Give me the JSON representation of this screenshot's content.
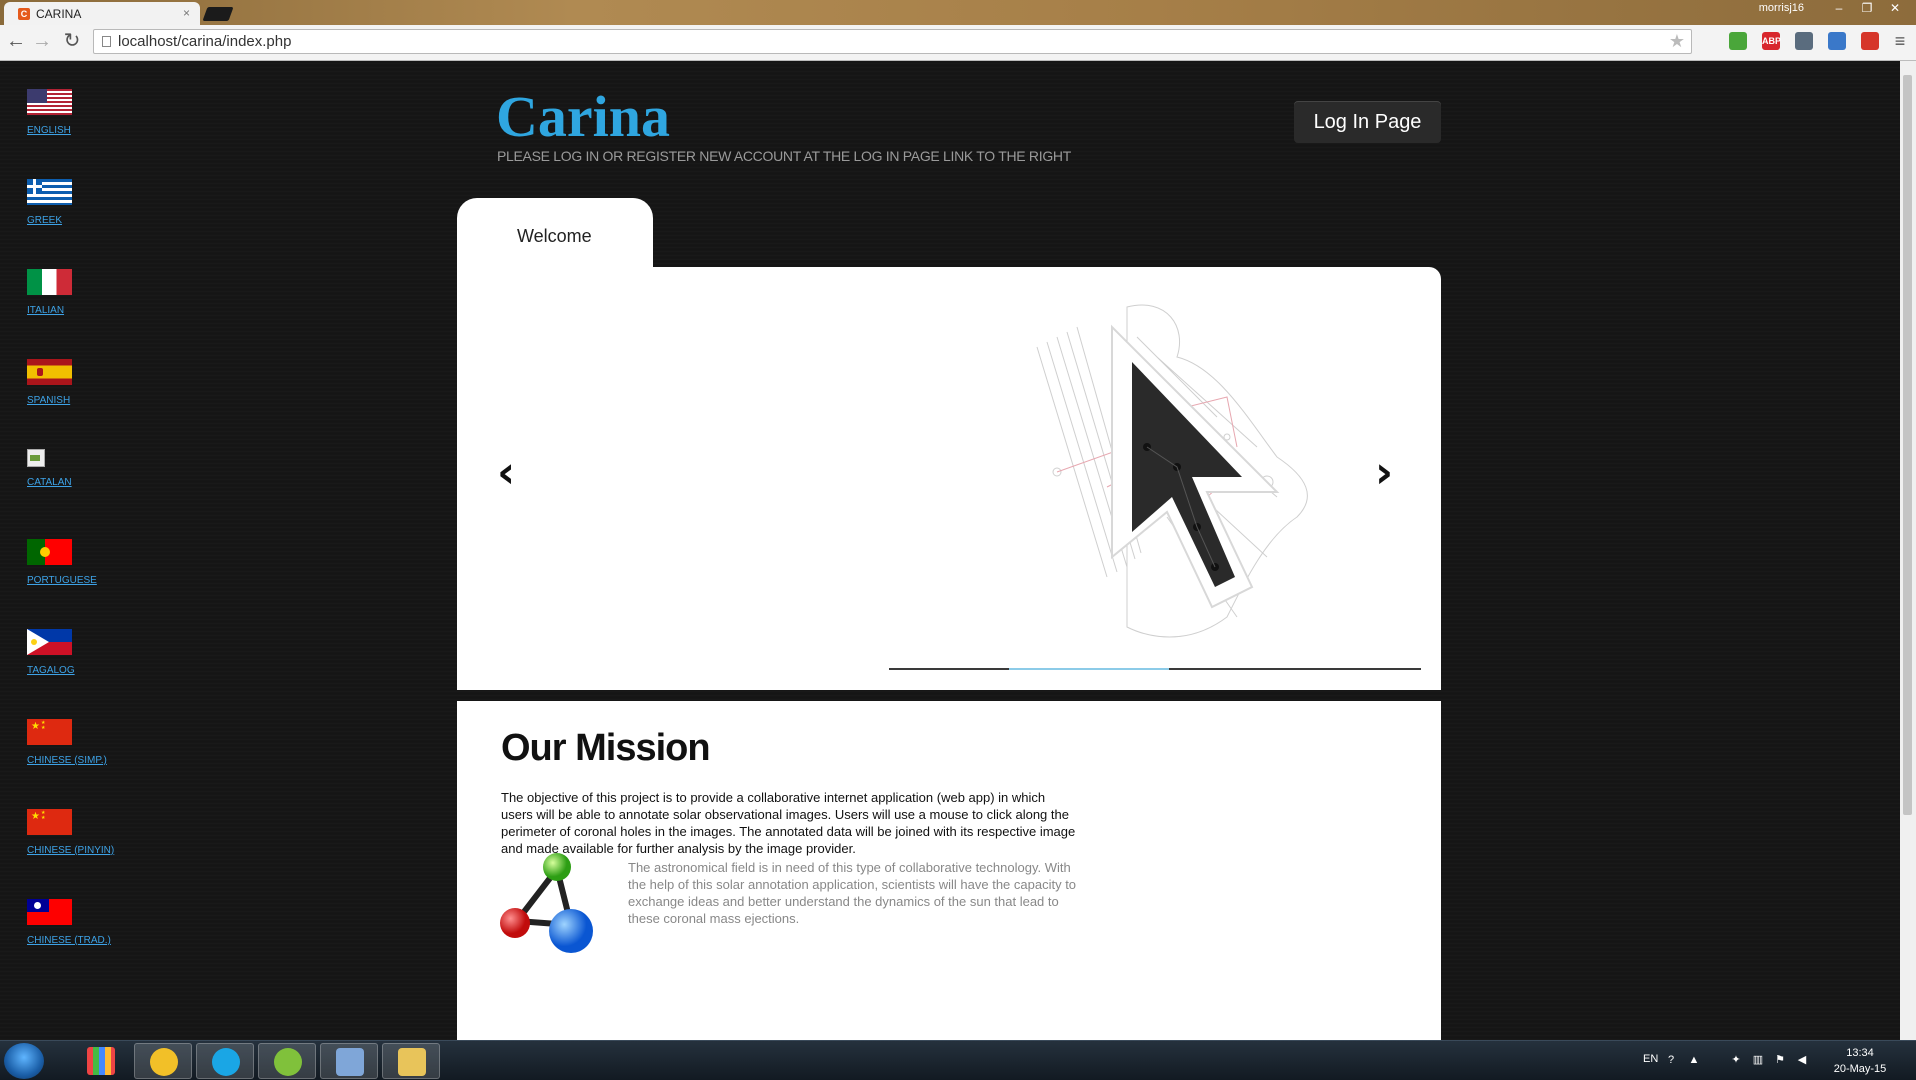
{
  "browser": {
    "tab_title": "CARINA",
    "tab_close": "×",
    "user": "morrisj16",
    "url": "localhost/carina/index.php",
    "back_glyph": "←",
    "forward_glyph": "→",
    "reload_glyph": "↻",
    "star_glyph": "★",
    "menu_glyph": "≡",
    "extensions": [
      {
        "name": "evernote-icon",
        "color": "#4aa63a",
        "text": ""
      },
      {
        "name": "adblock-icon",
        "color": "#d8262d",
        "text": "ABP"
      },
      {
        "name": "equalizer-icon",
        "color": "#5a6c7e",
        "text": ""
      },
      {
        "name": "translate-icon",
        "color": "#3a78c9",
        "text": ""
      },
      {
        "name": "dictionary-icon",
        "color": "#d6362a",
        "text": ""
      }
    ]
  },
  "sidebar": {
    "languages": [
      {
        "label": "ENGLISH",
        "flag": "us-flag-icon"
      },
      {
        "label": "GREEK",
        "flag": "greece-flag-icon"
      },
      {
        "label": "ITALIAN",
        "flag": "italy-flag-icon"
      },
      {
        "label": "SPANISH",
        "flag": "spain-flag-icon"
      },
      {
        "label": "CATALAN",
        "flag": "broken-image-icon"
      },
      {
        "label": "PORTUGUESE",
        "flag": "portugal-flag-icon"
      },
      {
        "label": "TAGALOG",
        "flag": "philippines-flag-icon"
      },
      {
        "label": "CHINESE (SIMP.)",
        "flag": "china-flag-icon"
      },
      {
        "label": "CHINESE (PINYIN)",
        "flag": "china-flag-icon"
      },
      {
        "label": "CHINESE (TRAD.)",
        "flag": "taiwan-flag-icon"
      }
    ]
  },
  "header": {
    "logo": "Carina",
    "tagline": "PLEASE LOG IN OR REGISTER NEW ACCOUNT AT THE LOG IN PAGE LINK TO THE RIGHT",
    "login_button": "Log In Page"
  },
  "welcome": {
    "tab_label": "Welcome",
    "prev_arrow": "‹",
    "next_arrow": "›",
    "slide_progress": 0.3
  },
  "mission": {
    "title": "Our Mission",
    "paragraph1": "The objective of this project is to provide a collaborative internet application (web app) in which users will be able to annotate solar observational images. Users will use a mouse to click along the perimeter of coronal holes in the images. The annotated data will be joined with its respective image and made available for further analysis by the image provider.",
    "paragraph2": "The astronomical field is in need of this type of collaborative technology. With the help of this solar annotation application, scientists will have the capacity to exchange ideas and better understand the dynamics of the sun that lead to these coronal mass ejections."
  },
  "taskbar": {
    "apps": [
      {
        "name": "apps-launcher-icon",
        "color": "#e9e9e9"
      },
      {
        "name": "chrome-icon",
        "color": "#f2c028"
      },
      {
        "name": "skype-icon",
        "color": "#1aa6e5"
      },
      {
        "name": "spotify-icon",
        "color": "#80c13b"
      },
      {
        "name": "virtualbox-icon",
        "color": "#7fa6d8"
      },
      {
        "name": "file-explorer-icon",
        "color": "#e8c45a"
      }
    ],
    "lang": "EN",
    "time": "13:34",
    "date": "20-May-15"
  }
}
